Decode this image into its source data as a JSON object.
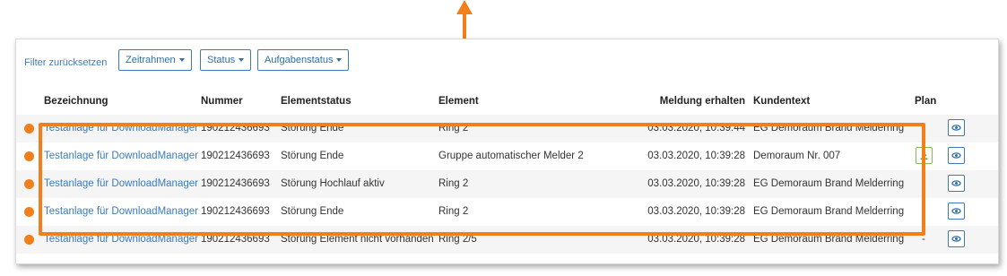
{
  "toolbar": {
    "filter_reset": "Filter zurücksetzen",
    "dropdowns": [
      "Zeitrahmen",
      "Status",
      "Aufgabenstatus"
    ]
  },
  "columns": {
    "bezeichnung": "Bezeichnung",
    "nummer": "Nummer",
    "elementstatus": "Elementstatus",
    "element": "Element",
    "meldung": "Meldung erhalten",
    "kundentext": "Kundentext",
    "plan": "Plan"
  },
  "rows": [
    {
      "bezeichnung": "Testanlage für DownloadManager",
      "nummer": "190212436693",
      "elementstatus": "Störung Ende",
      "element": "Ring 2",
      "meldung": "03.03.2020, 10:39:44",
      "kundentext": "EG Demoraum Brand Melderring",
      "plan": "-"
    },
    {
      "bezeichnung": "Testanlage für DownloadManager",
      "nummer": "190212436693",
      "elementstatus": "Störung Ende",
      "element": "Gruppe automatischer Melder 2",
      "meldung": "03.03.2020, 10:39:28",
      "kundentext": "Demoraum Nr. 007",
      "plan": "download"
    },
    {
      "bezeichnung": "Testanlage für DownloadManager",
      "nummer": "190212436693",
      "elementstatus": "Störung Hochlauf aktiv",
      "element": "Ring 2",
      "meldung": "03.03.2020, 10:39:28",
      "kundentext": "EG Demoraum Brand Melderring",
      "plan": "-"
    },
    {
      "bezeichnung": "Testanlage für DownloadManager",
      "nummer": "190212436693",
      "elementstatus": "Störung Ende",
      "element": "Ring 2",
      "meldung": "03.03.2020, 10:39:28",
      "kundentext": "EG Demoraum Brand Melderring",
      "plan": "-"
    },
    {
      "bezeichnung": "Testanlage für DownloadManager",
      "nummer": "190212436693",
      "elementstatus": "Störung Element nicht vorhanden",
      "element": "Ring 2/5",
      "meldung": "03.03.2020, 10:39:28",
      "kundentext": "EG Demoraum Brand Melderring",
      "plan": "-"
    }
  ],
  "colors": {
    "accent": "#f07f1c",
    "link": "#3a7bbf",
    "download": "#7fbf4d"
  },
  "icons": {
    "status": "status-dot-icon",
    "view": "view-icon",
    "download": "download-icon"
  }
}
